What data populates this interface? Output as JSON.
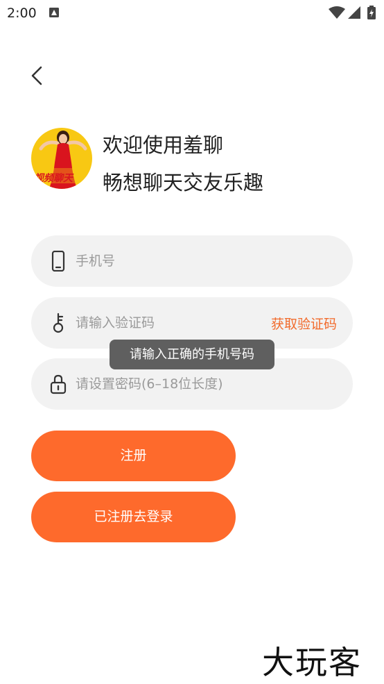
{
  "status_bar": {
    "time": "2:00"
  },
  "header": {
    "back_icon": "chevron-left-icon"
  },
  "welcome": {
    "line1": "欢迎使用羞聊",
    "line2": "畅想聊天交友乐趣",
    "logo_text": "视频聊天"
  },
  "form": {
    "phone_placeholder": "手机号",
    "code_placeholder": "请输入验证码",
    "get_code_label": "获取验证码",
    "password_placeholder": "请设置密码(6–18位长度)"
  },
  "toast": {
    "message": "请输入正确的手机号码"
  },
  "buttons": {
    "register_label": "注册",
    "go_login_label": "已注册去登录"
  },
  "watermark": {
    "text": "大玩客"
  },
  "colors": {
    "accent": "#fe6a2c",
    "link": "#f26b2c",
    "field_bg": "#f2f2f2",
    "toast_bg": "#5f5f5f",
    "logo_bg": "#f8c813"
  }
}
